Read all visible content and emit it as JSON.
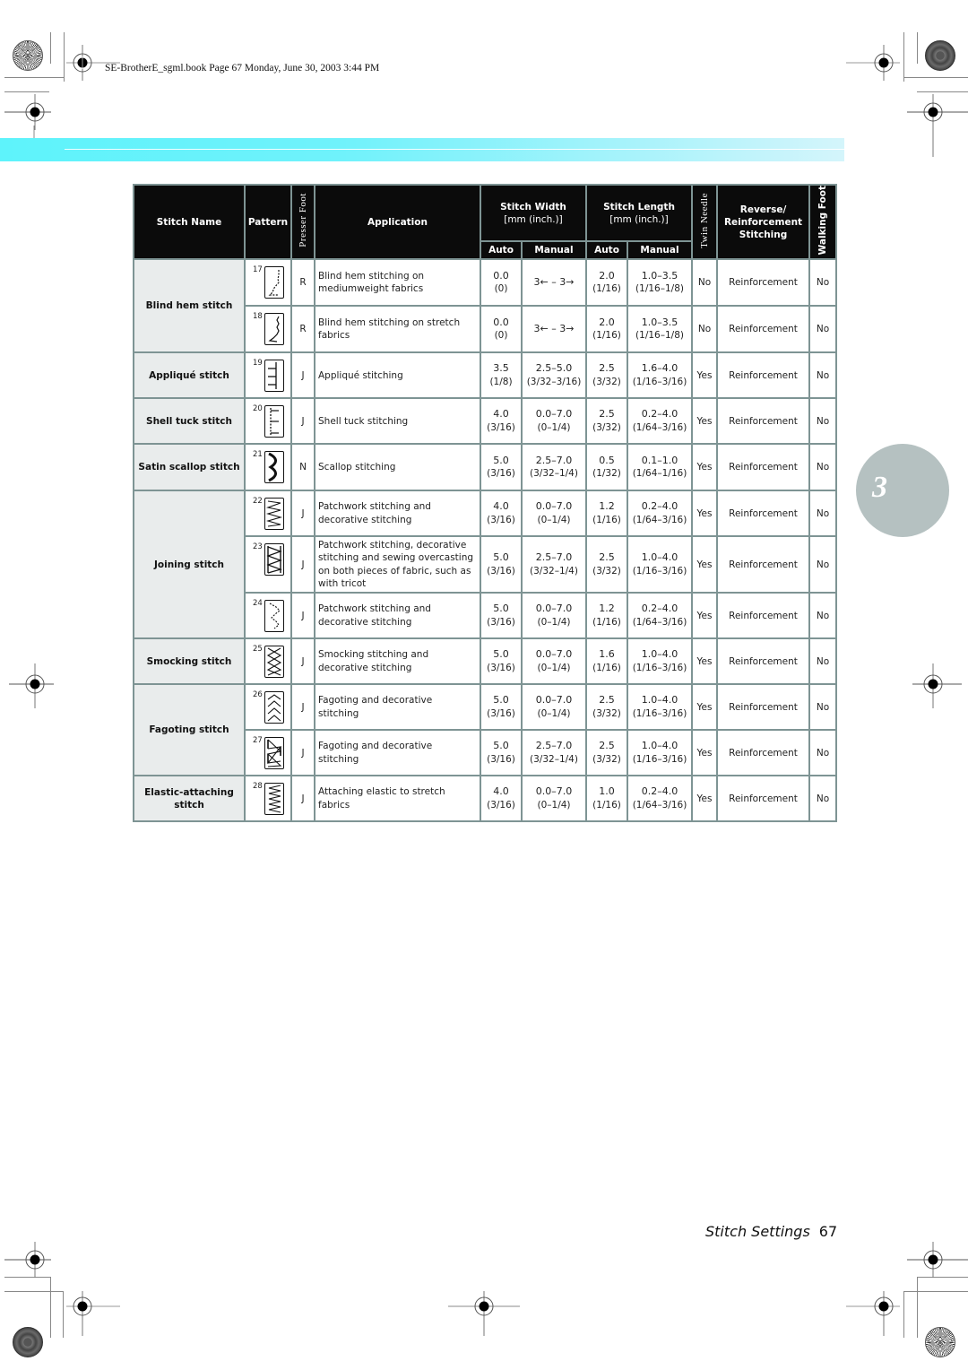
{
  "header": {
    "meta": "SE-BrotherE_sgml.book  Page 67  Monday, June 30, 2003  3:44 PM"
  },
  "chapter_tab": "3",
  "table": {
    "headers": {
      "stitch_name": "Stitch Name",
      "pattern": "Pattern",
      "presser_foot": "Presser Foot",
      "application": "Application",
      "stitch_width": "Stitch Width",
      "stitch_width_unit": "[mm (inch.)]",
      "stitch_length": "Stitch Length",
      "stitch_length_unit": "[mm (inch.)]",
      "twin_needle": "Twin Needle",
      "reverse": "Reverse/",
      "reinforcement": "Reinforcement",
      "stitching": "Stitching",
      "walking_foot": "Walking Foot",
      "auto": "Auto",
      "manual": "Manual"
    },
    "groups": [
      {
        "name": "Blind hem stitch",
        "rows": [
          0,
          1
        ]
      },
      {
        "name": "Appliqué stitch",
        "rows": [
          2
        ]
      },
      {
        "name": "Shell tuck stitch",
        "rows": [
          3
        ]
      },
      {
        "name": "Satin scallop stitch",
        "rows": [
          4
        ]
      },
      {
        "name": "Joining stitch",
        "rows": [
          5,
          6,
          7
        ]
      },
      {
        "name": "Smocking stitch",
        "rows": [
          8
        ]
      },
      {
        "name": "Fagoting stitch",
        "rows": [
          9,
          10
        ]
      },
      {
        "name": "Elastic-attaching stitch",
        "name_line1": "Elastic-attaching",
        "name_line2": "stitch",
        "rows": [
          11
        ]
      }
    ],
    "rows": [
      {
        "pattern_num": "17",
        "pattern_icon": "blind-hem-pattern-icon",
        "foot": "R",
        "app1": "Blind hem stitching on",
        "app2": "mediumweight fabrics",
        "app3": "",
        "app4": "",
        "w_auto": "0.0",
        "w_auto_in": "(0)",
        "w_man": "3← – 3→",
        "w_man_in": "",
        "l_auto": "2.0",
        "l_auto_in": "(1/16)",
        "l_man": "1.0–3.5",
        "l_man_in": "(1/16–1/8)",
        "twin": "No",
        "reverse": "Reinforcement",
        "walking": "No"
      },
      {
        "pattern_num": "18",
        "pattern_icon": "stretch-blind-hem-pattern-icon",
        "foot": "R",
        "app1": "Blind hem stitching on stretch",
        "app2": "fabrics",
        "app3": "",
        "app4": "",
        "w_auto": "0.0",
        "w_auto_in": "(0)",
        "w_man": "3← – 3→",
        "w_man_in": "",
        "l_auto": "2.0",
        "l_auto_in": "(1/16)",
        "l_man": "1.0–3.5",
        "l_man_in": "(1/16–1/8)",
        "twin": "No",
        "reverse": "Reinforcement",
        "walking": "No"
      },
      {
        "pattern_num": "19",
        "pattern_icon": "applique-pattern-icon",
        "foot": "J",
        "app1": "Appliqué stitching",
        "app2": "",
        "app3": "",
        "app4": "",
        "w_auto": "3.5",
        "w_auto_in": "(1/8)",
        "w_man": "2.5–5.0",
        "w_man_in": "(3/32–3/16)",
        "l_auto": "2.5",
        "l_auto_in": "(3/32)",
        "l_man": "1.6–4.0",
        "l_man_in": "(1/16–3/16)",
        "twin": "Yes",
        "reverse": "Reinforcement",
        "walking": "No"
      },
      {
        "pattern_num": "20",
        "pattern_icon": "shell-tuck-pattern-icon",
        "foot": "J",
        "app1": "Shell tuck stitching",
        "app2": "",
        "app3": "",
        "app4": "",
        "w_auto": "4.0",
        "w_auto_in": "(3/16)",
        "w_man": "0.0–7.0",
        "w_man_in": "(0–1/4)",
        "l_auto": "2.5",
        "l_auto_in": "(3/32)",
        "l_man": "0.2–4.0",
        "l_man_in": "(1/64–3/16)",
        "twin": "Yes",
        "reverse": "Reinforcement",
        "walking": "No"
      },
      {
        "pattern_num": "21",
        "pattern_icon": "satin-scallop-pattern-icon",
        "foot": "N",
        "app1": "Scallop stitching",
        "app2": "",
        "app3": "",
        "app4": "",
        "w_auto": "5.0",
        "w_auto_in": "(3/16)",
        "w_man": "2.5–7.0",
        "w_man_in": "(3/32–1/4)",
        "l_auto": "0.5",
        "l_auto_in": "(1/32)",
        "l_man": "0.1–1.0",
        "l_man_in": "(1/64–1/16)",
        "twin": "Yes",
        "reverse": "Reinforcement",
        "walking": "No"
      },
      {
        "pattern_num": "22",
        "pattern_icon": "joining-zigzag-pattern-icon",
        "foot": "J",
        "app1": "Patchwork stitching and",
        "app2": "decorative stitching",
        "app3": "",
        "app4": "",
        "w_auto": "4.0",
        "w_auto_in": "(3/16)",
        "w_man": "0.0–7.0",
        "w_man_in": "(0–1/4)",
        "l_auto": "1.2",
        "l_auto_in": "(1/16)",
        "l_man": "0.2–4.0",
        "l_man_in": "(1/64–3/16)",
        "twin": "Yes",
        "reverse": "Reinforcement",
        "walking": "No"
      },
      {
        "pattern_num": "23",
        "pattern_icon": "joining-overcast-pattern-icon",
        "foot": "J",
        "app1": "Patchwork stitching, decorative",
        "app2": "stitching and sewing overcasting",
        "app3": "on both pieces of fabric, such as",
        "app4": "with tricot",
        "w_auto": "5.0",
        "w_auto_in": "(3/16)",
        "w_man": "2.5–7.0",
        "w_man_in": "(3/32–1/4)",
        "l_auto": "2.5",
        "l_auto_in": "(3/32)",
        "l_man": "1.0–4.0",
        "l_man_in": "(1/16–3/16)",
        "twin": "Yes",
        "reverse": "Reinforcement",
        "walking": "No"
      },
      {
        "pattern_num": "24",
        "pattern_icon": "joining-feather-pattern-icon",
        "foot": "J",
        "app1": "Patchwork stitching and",
        "app2": "decorative stitching",
        "app3": "",
        "app4": "",
        "w_auto": "5.0",
        "w_auto_in": "(3/16)",
        "w_man": "0.0–7.0",
        "w_man_in": "(0–1/4)",
        "l_auto": "1.2",
        "l_auto_in": "(1/16)",
        "l_man": "0.2–4.0",
        "l_man_in": "(1/64–3/16)",
        "twin": "Yes",
        "reverse": "Reinforcement",
        "walking": "No"
      },
      {
        "pattern_num": "25",
        "pattern_icon": "smocking-pattern-icon",
        "foot": "J",
        "app1": "Smocking stitching and",
        "app2": "decorative stitching",
        "app3": "",
        "app4": "",
        "w_auto": "5.0",
        "w_auto_in": "(3/16)",
        "w_man": "0.0–7.0",
        "w_man_in": "(0–1/4)",
        "l_auto": "1.6",
        "l_auto_in": "(1/16)",
        "l_man": "1.0–4.0",
        "l_man_in": "(1/16–3/16)",
        "twin": "Yes",
        "reverse": "Reinforcement",
        "walking": "No"
      },
      {
        "pattern_num": "26",
        "pattern_icon": "fagoting-chevron-pattern-icon",
        "foot": "J",
        "app1": "Fagoting and decorative",
        "app2": "stitching",
        "app3": "",
        "app4": "",
        "w_auto": "5.0",
        "w_auto_in": "(3/16)",
        "w_man": "0.0–7.0",
        "w_man_in": "(0–1/4)",
        "l_auto": "2.5",
        "l_auto_in": "(3/32)",
        "l_man": "1.0–4.0",
        "l_man_in": "(1/16–3/16)",
        "twin": "Yes",
        "reverse": "Reinforcement",
        "walking": "No"
      },
      {
        "pattern_num": "27",
        "pattern_icon": "fagoting-bowtie-pattern-icon",
        "foot": "J",
        "app1": "Fagoting and decorative",
        "app2": "stitching",
        "app3": "",
        "app4": "",
        "w_auto": "5.0",
        "w_auto_in": "(3/16)",
        "w_man": "2.5–7.0",
        "w_man_in": "(3/32–1/4)",
        "l_auto": "2.5",
        "l_auto_in": "(3/32)",
        "l_man": "1.0–4.0",
        "l_man_in": "(1/16–3/16)",
        "twin": "Yes",
        "reverse": "Reinforcement",
        "walking": "No"
      },
      {
        "pattern_num": "28",
        "pattern_icon": "elastic-attaching-pattern-icon",
        "foot": "J",
        "app1": "Attaching elastic to stretch",
        "app2": "fabrics",
        "app3": "",
        "app4": "",
        "w_auto": "4.0",
        "w_auto_in": "(3/16)",
        "w_man": "0.0–7.0",
        "w_man_in": "(0–1/4)",
        "l_auto": "1.0",
        "l_auto_in": "(1/16)",
        "l_man": "0.2–4.0",
        "l_man_in": "(1/64–3/16)",
        "twin": "Yes",
        "reverse": "Reinforcement",
        "walking": "No"
      }
    ]
  },
  "footer": {
    "section_title": "Stitch Settings",
    "page_number": "67"
  }
}
